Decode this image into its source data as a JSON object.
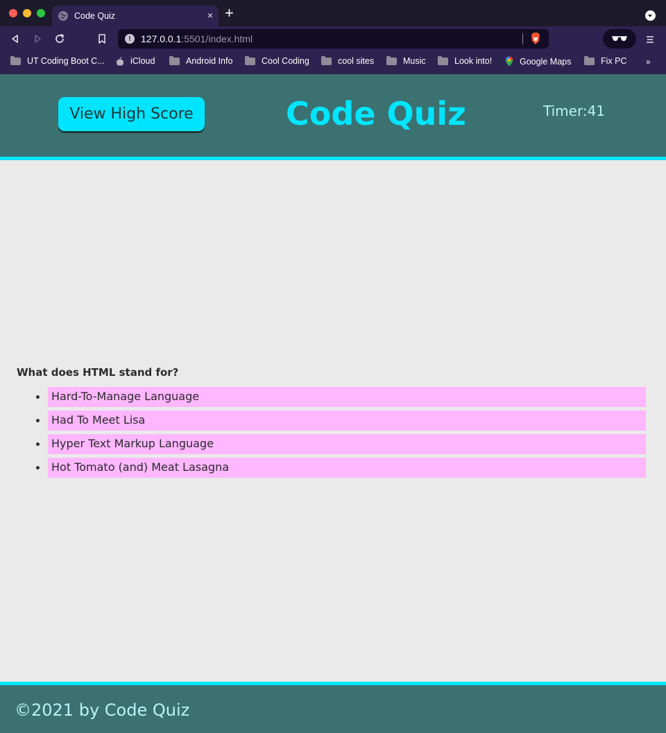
{
  "browser": {
    "tab_title": "Code Quiz",
    "tab_close": "×",
    "new_tab": "+",
    "url_host": "127.0.0.1",
    "url_path": ":5501/index.html",
    "bookmarks": [
      {
        "label": "UT Coding Boot C...",
        "icon": "folder-icon"
      },
      {
        "label": "iCloud",
        "icon": "apple-icon"
      },
      {
        "label": "Android Info",
        "icon": "folder-icon"
      },
      {
        "label": "Cool Coding",
        "icon": "folder-icon"
      },
      {
        "label": "cool sites",
        "icon": "folder-icon"
      },
      {
        "label": "Music",
        "icon": "folder-icon"
      },
      {
        "label": "Look into!",
        "icon": "folder-icon"
      },
      {
        "label": "Google Maps",
        "icon": "maps-icon"
      },
      {
        "label": "Fix PC",
        "icon": "folder-icon"
      }
    ],
    "bookmarks_more": "»",
    "colors": {
      "tabstrip": "#1c1a2b",
      "toolbar": "#2d2350",
      "url_bar": "#120c26"
    }
  },
  "header": {
    "high_score_button": "View High Score",
    "title": "Code Quiz",
    "timer_label": "Timer:",
    "timer_value": "41"
  },
  "quiz": {
    "question": "What does HTML stand for?",
    "answers": [
      "Hard-To-Manage Language",
      "Had To Meet Lisa",
      "Hyper Text Markup Language",
      "Hot Tomato (and) Meat Lasagna"
    ]
  },
  "footer": {
    "text": "©2021 by Code Quiz"
  },
  "colors": {
    "header_bg": "#3b7171",
    "accent": "#00e5ff",
    "answer_bg": "#ffb7ff",
    "page_bg": "#eaeaea"
  }
}
